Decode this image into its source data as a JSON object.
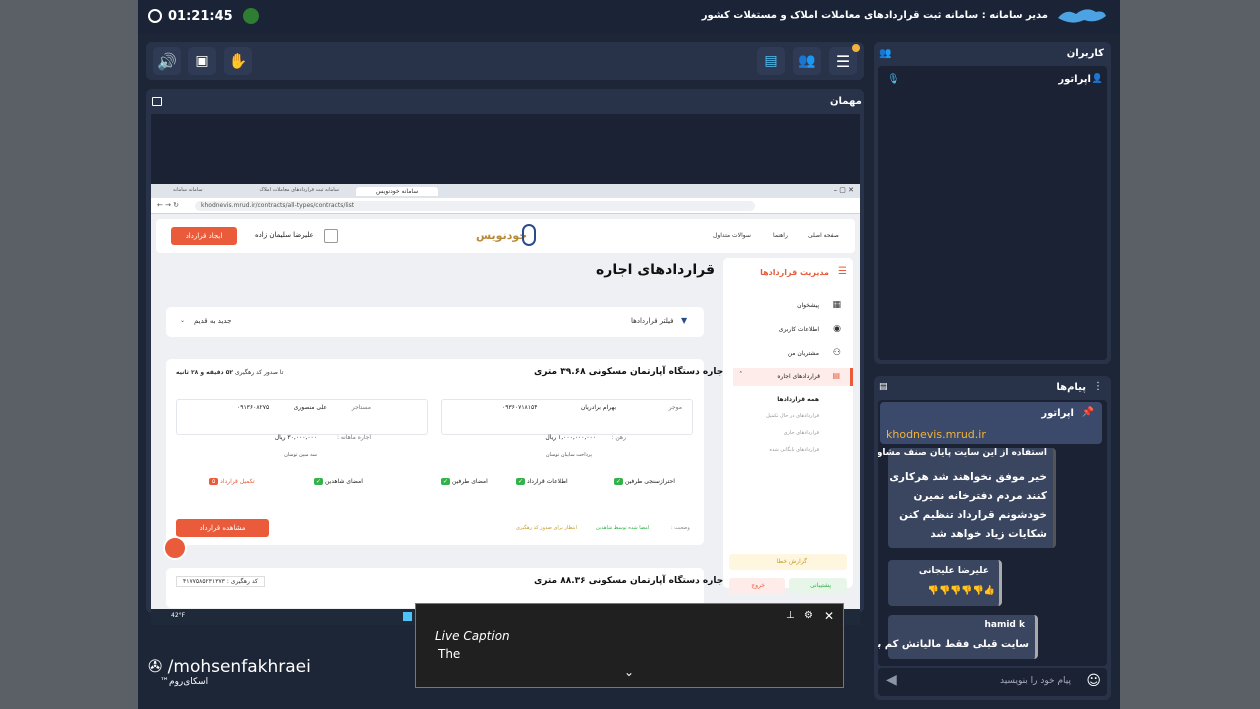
{
  "topbar": {
    "time": "01:21:45",
    "title": "مدیر سامانه : سامانه ثبت قراردادهای معاملات املاک و مستغلات کشور"
  },
  "stage": {
    "label": "مهمان"
  },
  "users": {
    "title": "کاربران",
    "operator": "اپراتور"
  },
  "browser": {
    "tabs": [
      "سامانه خودنویس",
      "سامانه ثبت قراردادهای معاملات املاک و مستغلات کشور",
      "سامانه سامانه"
    ],
    "url": "khodnevis.mrud.ir/contracts/all-types/contracts/list"
  },
  "site": {
    "nav": [
      "صفحه اصلی",
      "راهنما",
      "سوالات متداول"
    ],
    "logo": "خودنویس",
    "user": "علیرضا سلیمان زاده",
    "create_btn": "ایجاد قرارداد",
    "page_title": "قراردادهای اجاره",
    "filter": "فیلتر قراردادها",
    "sort": "جدید به قدیم",
    "sidebar_title": "مدیریت قراردادها",
    "sidebar_items": [
      "پیشخوان",
      "اطلاعات کاربری",
      "مشتریان من",
      "قراردادهای اجاره"
    ],
    "sub_items": [
      "همه قراردادها",
      "قراردادهای در حال تکمیل",
      "قراردادهای جاری",
      "قراردادهای بایگانی شده"
    ],
    "report": "گزارش خطا",
    "support": "پشتیبانی",
    "logout": "خروج"
  },
  "contract1": {
    "title": "اجاره دستگاه آپارتمان مسکونی ۳۹.۶۸ متری",
    "timer": "۵۲ دقیقه و ۲۸ ثانیه",
    "timer_note": "تا صدور کد رهگیری",
    "landlord_label": "موجر",
    "landlord_name": "بهرام برادریان",
    "landlord_phone": "۰۹۳۶۰۷۱۸۱۵۴",
    "tenant_label": "مستاجر",
    "tenant_name": "علی منصوری",
    "tenant_phone": "۰۹۱۳۶۰۸۲۷۵",
    "deposit": "۱,۰۰۰,۰۰۰,۰۰۰ ریال",
    "deposit_label": "رهن :",
    "rent": "۳۰,۰۰۰,۰۰۰ ریال",
    "rent_label": "اجاره ماهانه :",
    "landlord_wallet": "پرداخت سایبان توسان",
    "tenant_wallet": "سه مبین توسان",
    "steps": [
      "احتراز‌سنجی طرفین",
      "اطلاعات قرارداد",
      "امضای طرفین",
      "امضای شاهدین",
      "تکمیل قرارداد"
    ],
    "step5_num": "۵",
    "status_label": "وضعیت :",
    "status_1": "امضا شده توسط شاهدین",
    "status_2": "انتظار برای صدور کد رهگیری",
    "view_btn": "مشاهده قرارداد"
  },
  "contract2": {
    "title": "اجاره دستگاه آپارتمان مسکونی ۸۸.۳۶ متری",
    "tracking": "کد رهگیری : ۴۱۷۷۵۸۵۲۳۱۳۷۳"
  },
  "chat": {
    "title": "پیام‌ها",
    "pinned_author": "اپراتور",
    "pinned_link": "khodnevis.mrud.ir",
    "msg1_top": "استفاده از این سایت پایان صنف مشاورین...",
    "msg1": "خیر موفق نخواهند شد هرکاری کنند مردم دفترخانه نمیرن خودشونم قرارداد تنظیم کنن شکایات زیاد خواهد شد",
    "msg2_author": "علیرضا علیجانی",
    "msg2": "👍👎👎👎👎👎",
    "msg3_author": "hamid k",
    "msg3": "سایت قبلی فقط مالیاتش کم بود؟",
    "input_placeholder": "پیام خود را بنویسید"
  },
  "caption": {
    "title": "Live Caption",
    "text": "The"
  },
  "watermark": {
    "handle": "/mohsenfakhraei",
    "brand": "اسکای‌روم™"
  },
  "taskbar": {
    "temp": "42°F"
  },
  "colors": {
    "accent": "#e95b3a",
    "green": "#34b24a",
    "highlight": "#f2c94c"
  }
}
